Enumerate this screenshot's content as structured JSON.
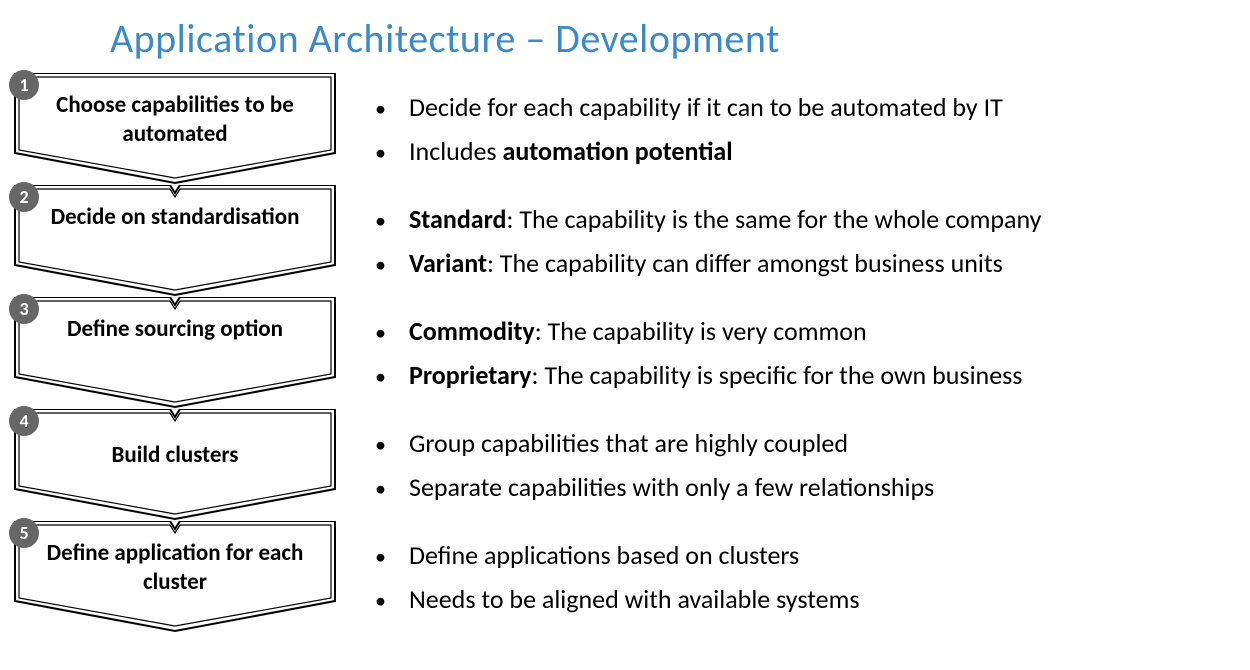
{
  "title": "Application Architecture – Development",
  "steps": [
    {
      "num": "1",
      "label": "Choose capabilities to be automated",
      "single": false
    },
    {
      "num": "2",
      "label": "Decide on standardisation",
      "single": false
    },
    {
      "num": "3",
      "label": "Define sourcing option",
      "single": false
    },
    {
      "num": "4",
      "label": "Build clusters",
      "single": true
    },
    {
      "num": "5",
      "label": "Define application for each cluster",
      "single": false
    }
  ],
  "bullets": [
    [
      {
        "lead": "",
        "rest": "Decide for each capability if it can to be automated by IT"
      },
      {
        "lead": "",
        "rest": "Includes ",
        "bold": "automation potential",
        "tail": ""
      }
    ],
    [
      {
        "bold": "Standard",
        "rest2": ": The capability is the same for the whole company"
      },
      {
        "bold": "Variant",
        "rest2": ": The capability can differ amongst business units"
      }
    ],
    [
      {
        "bold": "Commodity",
        "rest2": ": The capability is very common"
      },
      {
        "bold": "Proprietary",
        "rest2": ": The capability is specific for the own business"
      }
    ],
    [
      {
        "lead": "",
        "rest": "Group capabilities that are highly coupled"
      },
      {
        "lead": "",
        "rest": "Separate capabilities with only a few relationships"
      }
    ],
    [
      {
        "lead": "",
        "rest": "Define applications based on clusters"
      },
      {
        "lead": "",
        "rest": "Needs to be aligned with available systems"
      }
    ]
  ]
}
